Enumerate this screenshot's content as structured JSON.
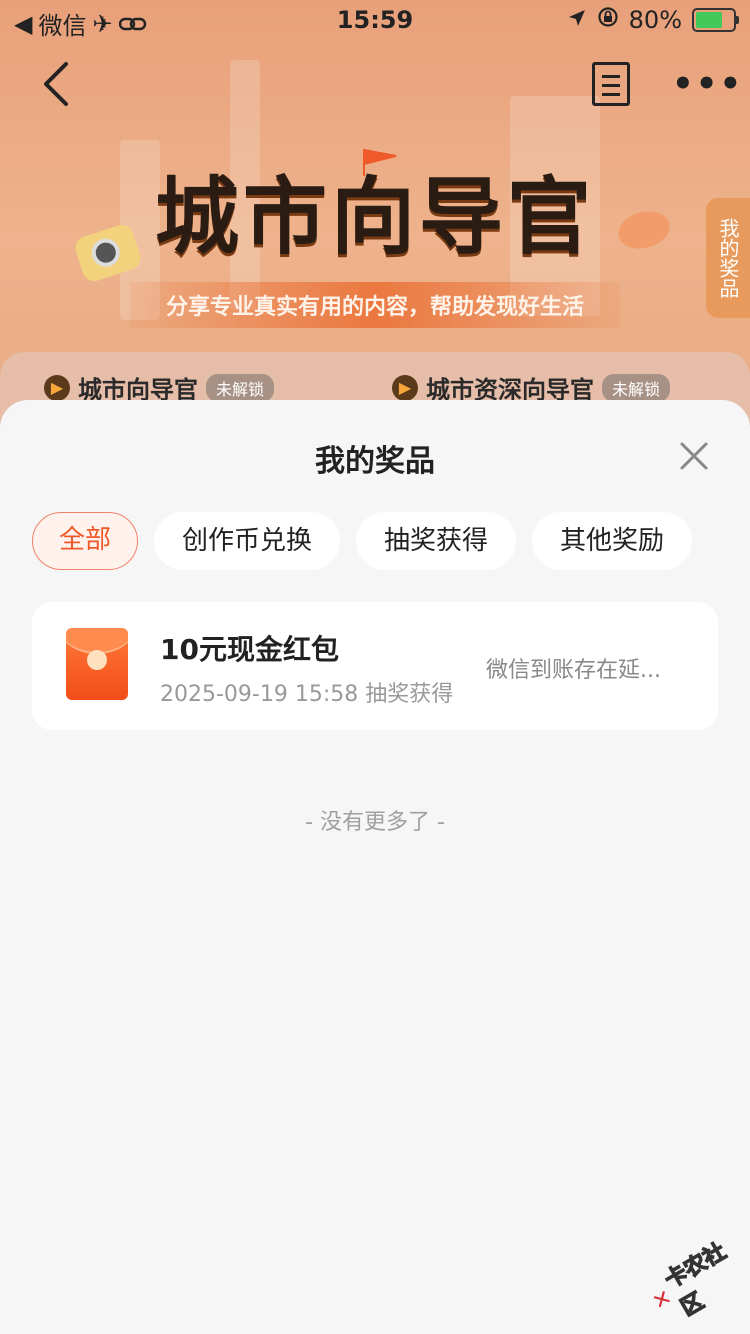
{
  "status_bar": {
    "back_app": "微信",
    "time": "15:59",
    "battery_text": "80%",
    "battery_level": 0.8
  },
  "background": {
    "hero_title": "城市向导官",
    "hero_subtitle": "分享专业真实有用的内容，帮助发现好生活",
    "side_tag": "我的奖品",
    "achievements": [
      {
        "name": "城市向导官",
        "lock": "未解锁"
      },
      {
        "name": "城市资深向导官",
        "lock": "未解锁"
      }
    ],
    "icons": {
      "back": "back-arrow-icon",
      "doc": "document-icon",
      "more": "more-dots-icon"
    }
  },
  "sheet": {
    "title": "我的奖品",
    "filters": [
      {
        "label": "全部",
        "active": true
      },
      {
        "label": "创作币兑换",
        "active": false
      },
      {
        "label": "抽奖获得",
        "active": false
      },
      {
        "label": "其他奖励",
        "active": false
      }
    ],
    "prizes": [
      {
        "name": "10元现金红包",
        "time": "2025-09-19 15:58",
        "source": "抽奖获得",
        "status": "微信到账存在延..."
      }
    ],
    "end_text": "- 没有更多了 -"
  },
  "watermark": {
    "text": "卡农社区"
  },
  "colors": {
    "accent": "#f05a2a",
    "accent_bg": "#fff1ec",
    "sheet_bg": "#f6f6f6",
    "card_bg": "#ffffff"
  }
}
